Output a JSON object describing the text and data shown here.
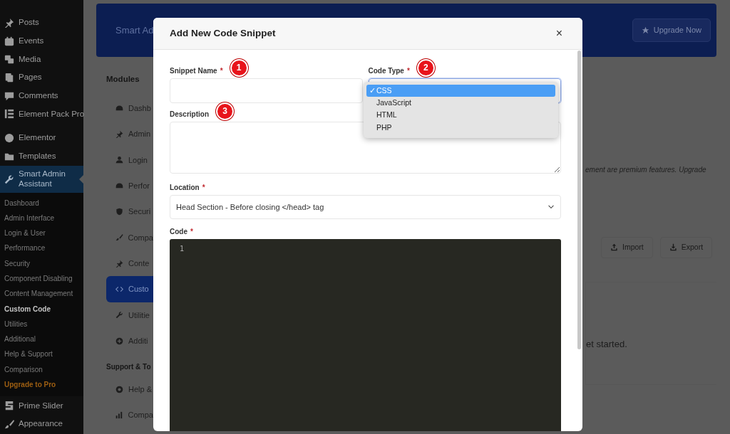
{
  "sidebar": {
    "items": [
      {
        "label": "Posts",
        "selected": false
      },
      {
        "label": "Events",
        "selected": false
      },
      {
        "label": "Media",
        "selected": false
      },
      {
        "label": "Pages",
        "selected": false
      },
      {
        "label": "Comments",
        "selected": false
      },
      {
        "label": "Element Pack Pro",
        "selected": false
      },
      {
        "label": "Elementor",
        "selected": false
      },
      {
        "label": "Templates",
        "selected": false
      },
      {
        "label": "Smart Admin Assistant",
        "selected": true,
        "children": [
          {
            "label": "Dashboard",
            "selected": false,
            "kind": "link"
          },
          {
            "label": "Admin Interface",
            "selected": false,
            "kind": "link"
          },
          {
            "label": "Login & User",
            "selected": false,
            "kind": "link"
          },
          {
            "label": "Performance",
            "selected": false,
            "kind": "link"
          },
          {
            "label": "Security",
            "selected": false,
            "kind": "link"
          },
          {
            "label": "Component Disabling",
            "selected": false,
            "kind": "link"
          },
          {
            "label": "Content Management",
            "selected": false,
            "kind": "link"
          },
          {
            "label": "Custom Code",
            "selected": true,
            "kind": "link"
          },
          {
            "label": "Utilities",
            "selected": false,
            "kind": "link"
          },
          {
            "label": "Additional",
            "selected": false,
            "kind": "link"
          },
          {
            "label": "Help & Support",
            "selected": false,
            "kind": "link"
          },
          {
            "label": "Comparison",
            "selected": false,
            "kind": "link"
          },
          {
            "label": "Upgrade to Pro",
            "selected": false,
            "kind": "upgrade"
          }
        ]
      },
      {
        "label": "Prime Slider",
        "selected": false
      },
      {
        "label": "Appearance",
        "selected": false
      }
    ]
  },
  "banner": {
    "title": "Smart Ad",
    "button": "Upgrade Now"
  },
  "modules": {
    "heading": "Modules",
    "items": [
      {
        "label": "Dashb",
        "selected": false
      },
      {
        "label": "Admin",
        "selected": false
      },
      {
        "label": "Login",
        "selected": false
      },
      {
        "label": "Perfor",
        "selected": false
      },
      {
        "label": "Securi",
        "selected": false
      },
      {
        "label": "Compa",
        "selected": false
      },
      {
        "label": "Conte",
        "selected": false
      },
      {
        "label": "Custo",
        "selected": true
      },
      {
        "label": "Utilitie",
        "selected": false
      },
      {
        "label": "Additi",
        "selected": false
      }
    ]
  },
  "support": {
    "heading": "Support & To",
    "items": [
      {
        "label": "Help &",
        "selected": false
      },
      {
        "label": "Compa",
        "selected": false
      }
    ]
  },
  "notice": "ement are premium features. Upgrade",
  "toolbar": [
    "Import",
    "Export"
  ],
  "empty_state": "et started.",
  "modal": {
    "title": "Add New Code Snippet",
    "close": "×",
    "snippet_name": {
      "label": "Snippet Name",
      "marker": "*",
      "callout": "1"
    },
    "code_type": {
      "label": "Code Type",
      "marker": "*",
      "callout": "2",
      "check": "✓",
      "options": [
        {
          "label": "CSS",
          "selected": true
        },
        {
          "label": "JavaScript",
          "selected": false
        },
        {
          "label": "HTML",
          "selected": false
        },
        {
          "label": "PHP",
          "selected": false
        }
      ]
    },
    "description": {
      "label": "Description",
      "callout": "3"
    },
    "location": {
      "label": "Location",
      "marker": "*",
      "value": "Head Section - Before closing </head> tag"
    },
    "code": {
      "label": "Code",
      "marker": "*",
      "line_numbers": [
        "1"
      ]
    }
  }
}
